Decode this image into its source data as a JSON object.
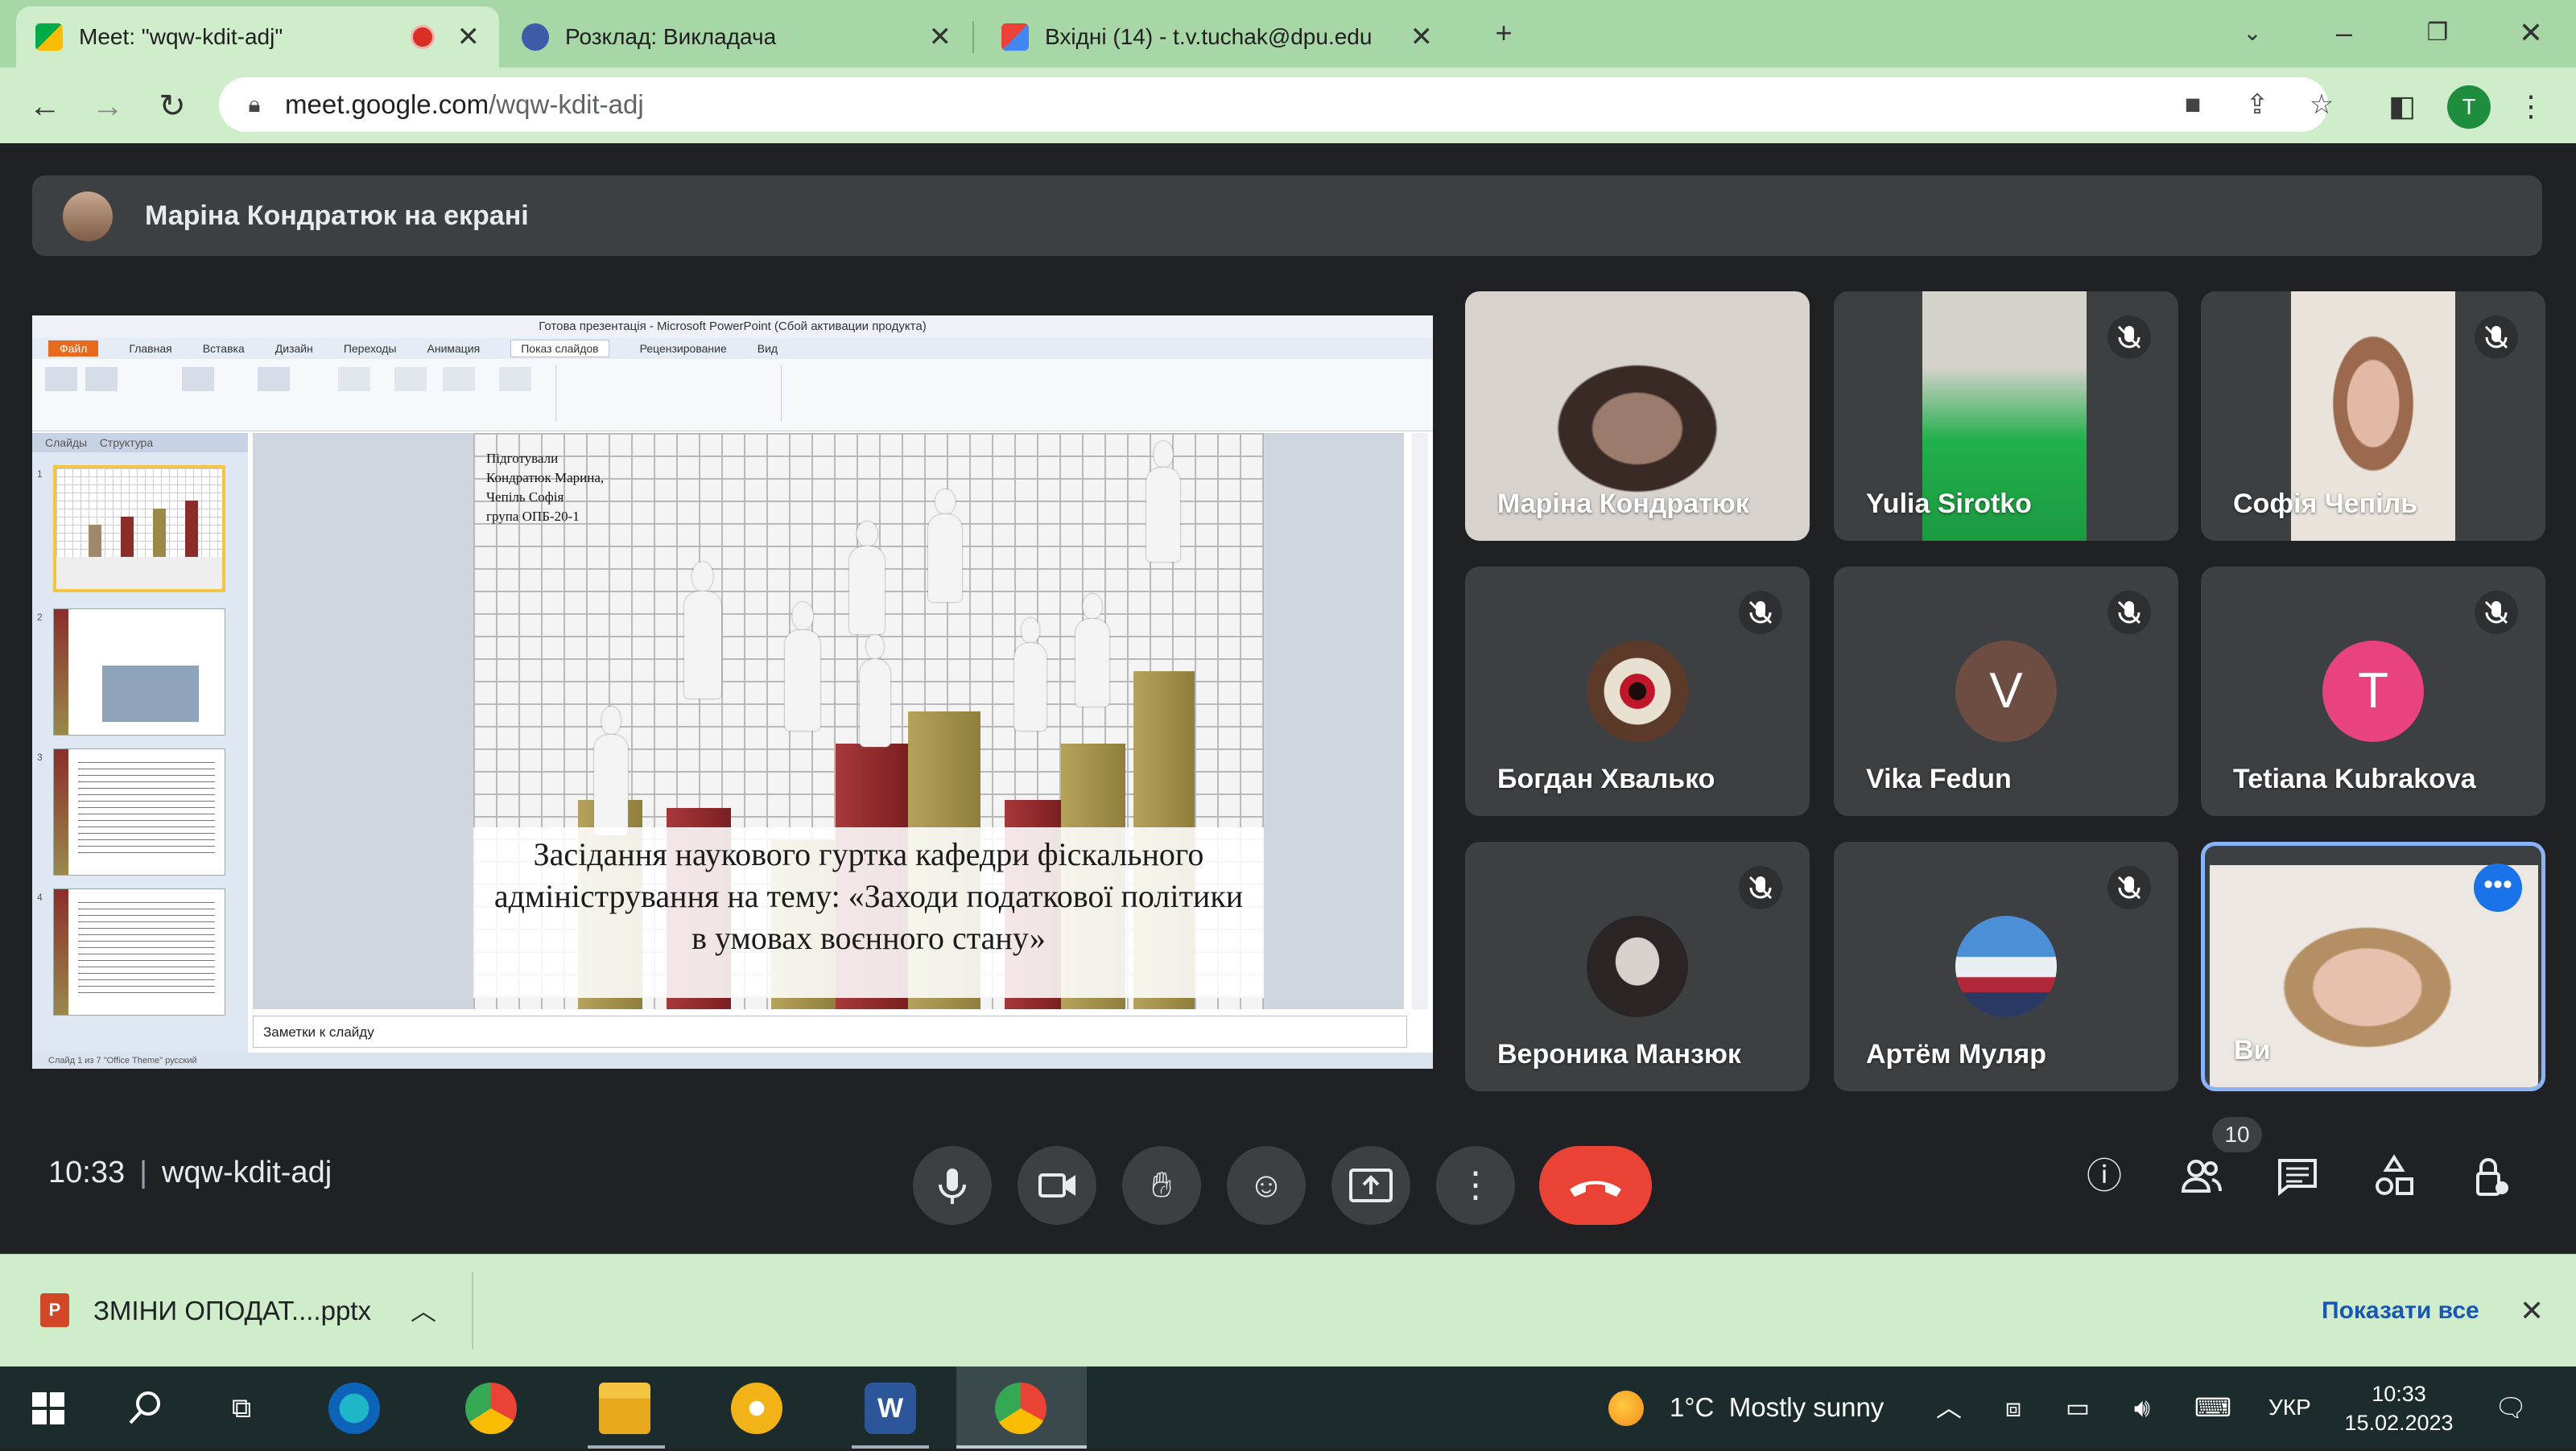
{
  "browser": {
    "tabs": [
      {
        "title": "Meet: \"wqw-kdit-adj\"",
        "active": true
      },
      {
        "title": "Розклад: Викладача",
        "active": false
      },
      {
        "title": "Вхідні (14) - t.v.tuchak@dpu.edu",
        "active": false
      }
    ],
    "url_host": "meet.google.com",
    "url_path": "/wqw-kdit-adj",
    "profile_initial": "T"
  },
  "meet": {
    "presenting_banner": "Маріна Кондратюк на екрані",
    "time": "10:33",
    "meeting_code": "wqw-kdit-adj",
    "participant_count": "10",
    "tiles": [
      {
        "name": "Маріна Кондратюк",
        "kind": "video",
        "muted": false
      },
      {
        "name": "Yulia Sirotko",
        "kind": "video",
        "muted": true
      },
      {
        "name": "Софія Чепіль",
        "kind": "video",
        "muted": true
      },
      {
        "name": "Богдан Хвалько",
        "kind": "avatar",
        "muted": true
      },
      {
        "name": "Vika Fedun",
        "kind": "initial",
        "initial": "V",
        "color": "#6d4c41",
        "muted": true
      },
      {
        "name": "Tetiana Kubrakova",
        "kind": "initial",
        "initial": "T",
        "color": "#e8437e",
        "muted": true
      },
      {
        "name": "Вероника Манзюк",
        "kind": "avatar",
        "muted": true
      },
      {
        "name": "Артём Муляр",
        "kind": "avatar",
        "muted": true
      },
      {
        "name": "Ви",
        "kind": "video",
        "muted": false,
        "self": true
      }
    ]
  },
  "presentation": {
    "window_title": "Готова презентація - Microsoft PowerPoint (Сбой активации продукта)",
    "ribbon_tabs": [
      "Файл",
      "Главная",
      "Вставка",
      "Дизайн",
      "Переходы",
      "Анимация",
      "Показ слайдов",
      "Рецензирование",
      "Вид"
    ],
    "left_tabs": [
      "Слайды",
      "Структура"
    ],
    "credit": "Підготували\nКондратюк Марина,\nЧепіль Софія\nгрупа ОПБ-20-1",
    "caption": "Засідання наукового гуртка кафедри фіскального адміністрування на тему: «Заходи податкової політики в умовах воєнного стану»",
    "notes_placeholder": "Заметки к слайду",
    "status": "Слайд 1 из 7   \"Office Theme\"   русский"
  },
  "download": {
    "file": "ЗМІНИ ОПОДАТ....pptx",
    "show_all": "Показати все"
  },
  "taskbar": {
    "weather_temp": "1°C",
    "weather_text": "Mostly sunny",
    "lang": "УКР",
    "time": "10:33",
    "date": "15.02.2023"
  },
  "colors": {
    "accent_green": "#a7d7a7",
    "meet_bg": "#202124",
    "hangup_red": "#ea4335",
    "self_border": "#8ab4f8"
  }
}
